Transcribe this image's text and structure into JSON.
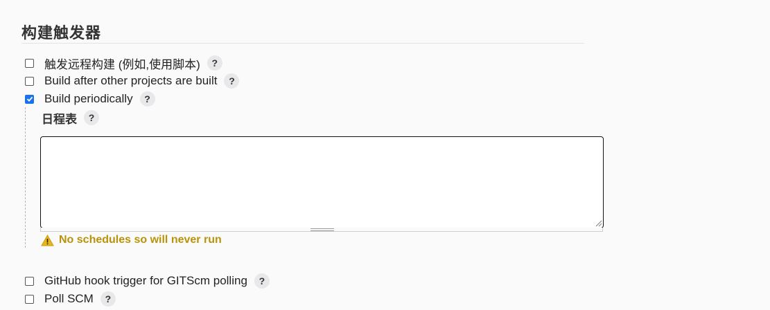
{
  "section": {
    "title": "构建触发器"
  },
  "triggers": [
    {
      "label": "触发远程构建 (例如,使用脚本)",
      "checked": false,
      "help": "?"
    },
    {
      "label": "Build after other projects are built",
      "checked": false,
      "help": "?"
    },
    {
      "label": "Build periodically",
      "checked": true,
      "help": "?"
    }
  ],
  "schedule": {
    "label": "日程表",
    "help": "?",
    "value": "",
    "warning": "No schedules so will never run"
  },
  "more_triggers": [
    {
      "label": "GitHub hook trigger for GITScm polling",
      "checked": false,
      "help": "?"
    },
    {
      "label": "Poll SCM",
      "checked": false,
      "help": "?"
    }
  ],
  "colors": {
    "checkbox_checked": "#1a73e8",
    "warning": "#b8930a",
    "help_bg": "#e8e8ea"
  }
}
